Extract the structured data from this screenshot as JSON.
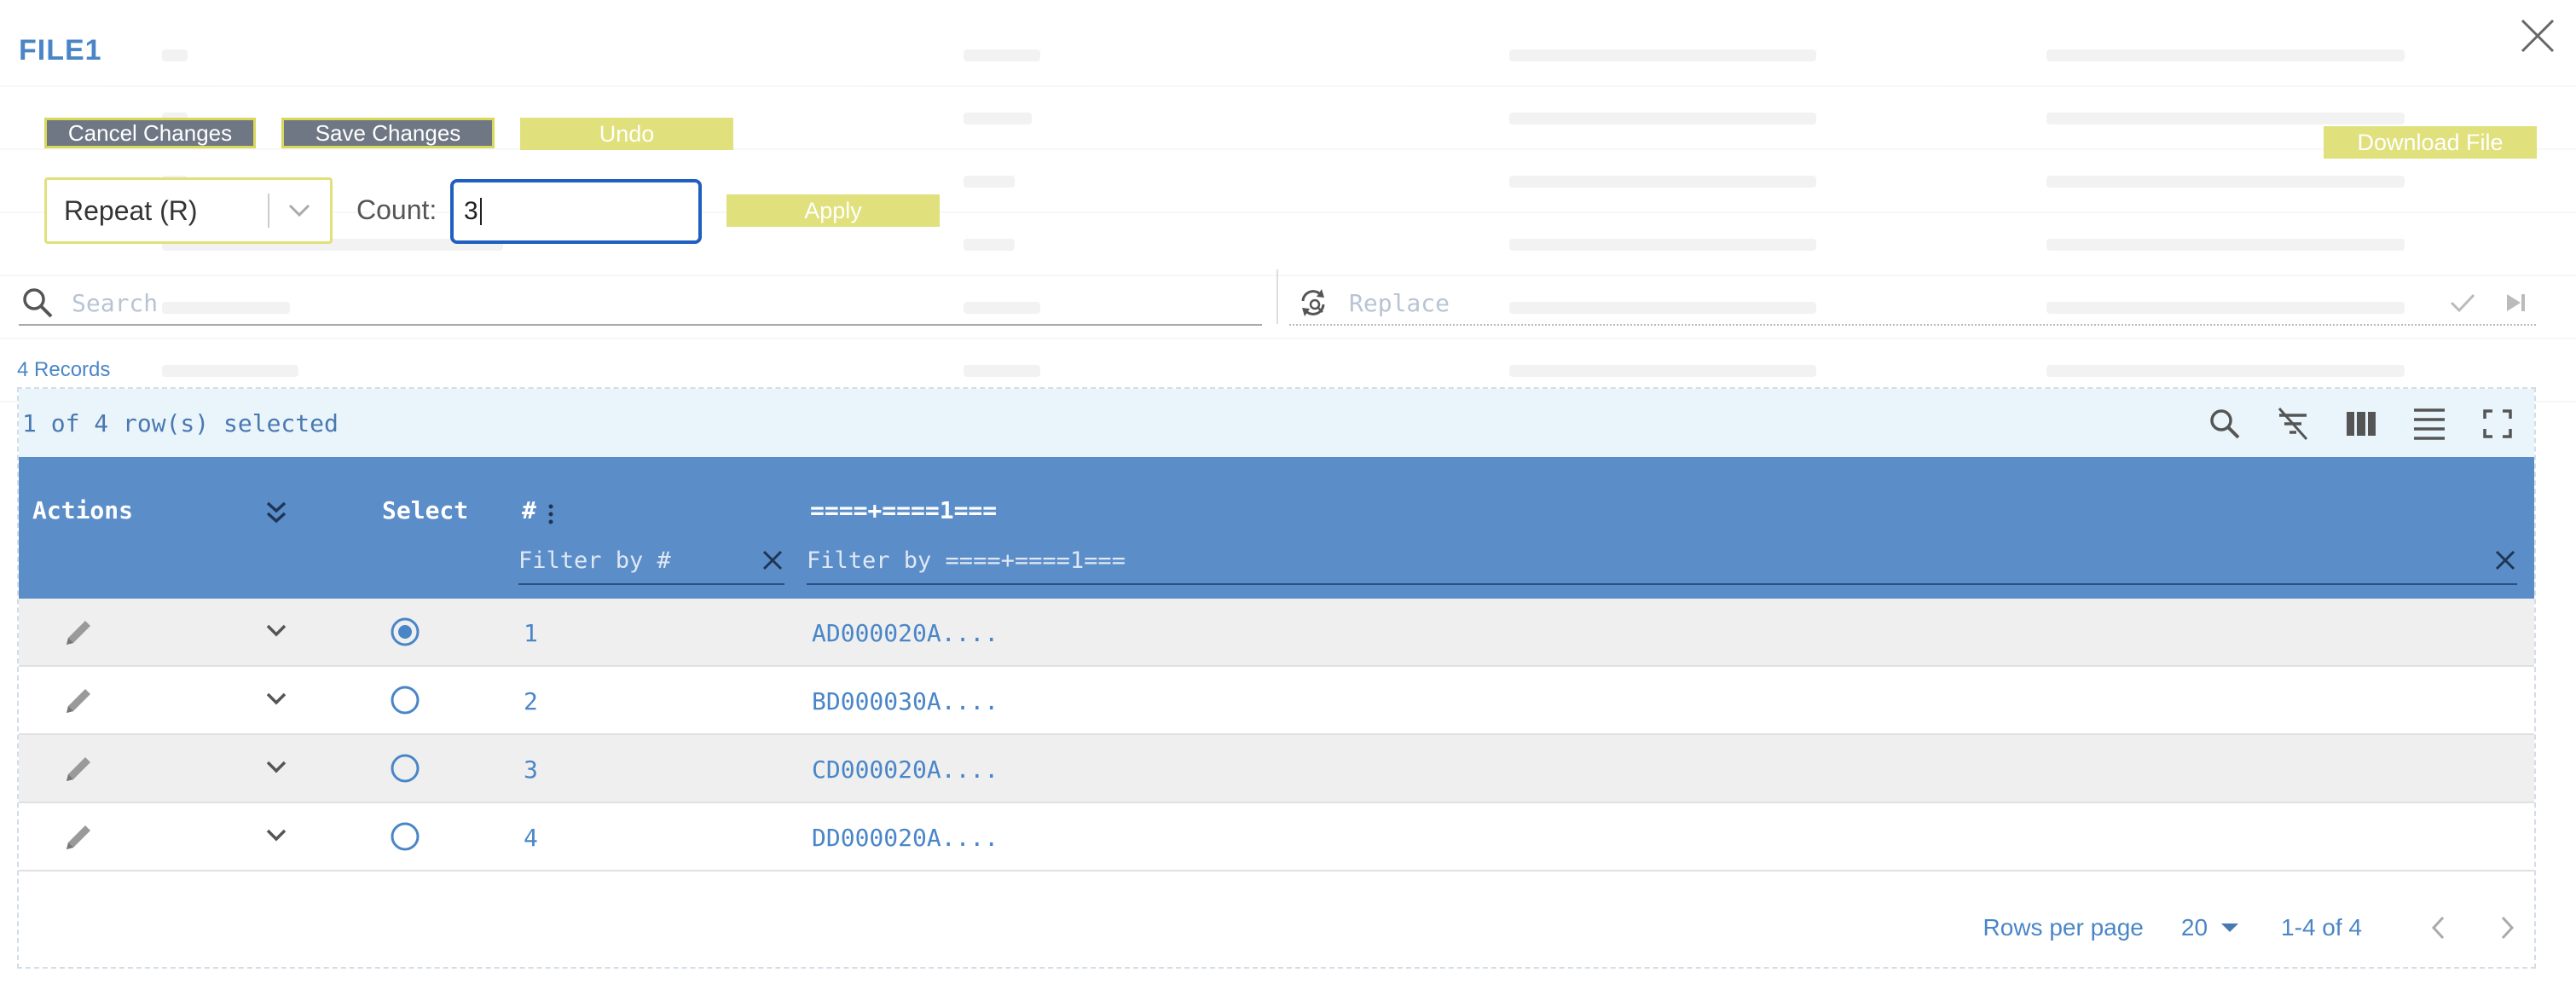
{
  "modal": {
    "title": "FILE1"
  },
  "toolbar": {
    "cancel_label": "Cancel Changes",
    "save_label": "Save Changes",
    "undo_label": "Undo",
    "download_label": "Download File",
    "apply_label": "Apply"
  },
  "operation": {
    "selected": "Repeat (R)",
    "count_label": "Count:",
    "count_value": "3"
  },
  "search": {
    "placeholder": "Search"
  },
  "replace": {
    "placeholder": "Replace"
  },
  "records_text": "4 Records",
  "selection_text": "1 of 4 row(s) selected",
  "columns": {
    "actions": "Actions",
    "select": "Select",
    "number": "#",
    "data": "====+====1===",
    "filter_number_placeholder": "Filter by #",
    "filter_data_placeholder": "Filter by ====+====1==="
  },
  "rows": [
    {
      "num": "1",
      "value": "AD000020A....",
      "selected": true
    },
    {
      "num": "2",
      "value": "BD000030A....",
      "selected": false
    },
    {
      "num": "3",
      "value": "CD000020A....",
      "selected": false
    },
    {
      "num": "4",
      "value": "DD000020A....",
      "selected": false
    }
  ],
  "pagination": {
    "rows_per_page_label": "Rows per page",
    "rows_per_page_value": "20",
    "range_text": "1-4 of 4"
  },
  "colors": {
    "accent": "#4a86c7",
    "header_bg": "#5b8dc9",
    "button_yellow": "#e0e07c",
    "button_dark": "#6f7785"
  }
}
